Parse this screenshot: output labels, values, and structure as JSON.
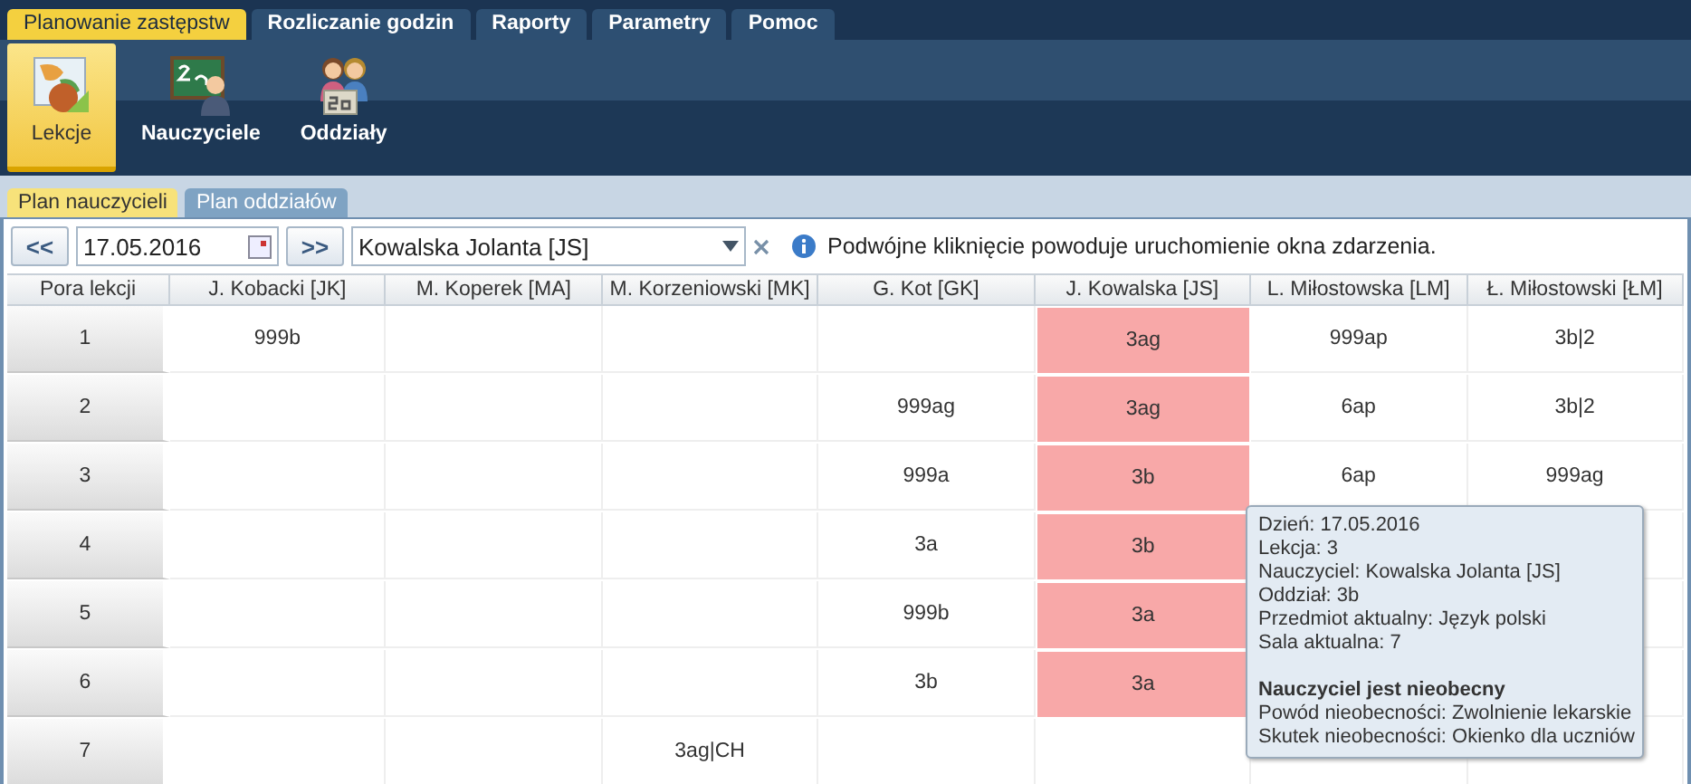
{
  "menu_tabs": [
    {
      "label": "Planowanie zastępstw",
      "selected": true
    },
    {
      "label": "Rozliczanie godzin",
      "selected": false
    },
    {
      "label": "Raporty",
      "selected": false
    },
    {
      "label": "Parametry",
      "selected": false
    },
    {
      "label": "Pomoc",
      "selected": false
    }
  ],
  "ribbon": [
    {
      "label": "Lekcje",
      "kind": "lessons",
      "selected": true
    },
    {
      "label": "Nauczyciele",
      "kind": "teachers",
      "selected": false
    },
    {
      "label": "Oddziały",
      "kind": "classes",
      "selected": false
    }
  ],
  "sub_tabs": [
    {
      "label": "Plan nauczycieli",
      "selected": true
    },
    {
      "label": "Plan oddziałów",
      "selected": false
    }
  ],
  "toolbar": {
    "prev": "<<",
    "date": "17.05.2016",
    "next": ">>",
    "teacher": "Kowalska Jolanta [JS]",
    "info": "Podwójne kliknięcie powoduje uruchomienie okna zdarzenia."
  },
  "table": {
    "columns": [
      "Pora lekcji",
      "J. Kobacki [JK]",
      "M. Koperek [MA]",
      "M. Korzeniowski [MK]",
      "G. Kot [GK]",
      "J. Kowalska [JS]",
      "L. Miłostowska [LM]",
      "Ł. Miłostowski [ŁM]"
    ],
    "rows": [
      {
        "cells": [
          {
            "text": "1"
          },
          {
            "text": "999b"
          },
          {
            "text": ""
          },
          {
            "text": ""
          },
          {
            "text": ""
          },
          {
            "text": "3ag",
            "absent": true
          },
          {
            "text": "999ap"
          },
          {
            "text": "3b|2"
          }
        ]
      },
      {
        "cells": [
          {
            "text": "2"
          },
          {
            "text": ""
          },
          {
            "text": ""
          },
          {
            "text": ""
          },
          {
            "text": "999ag"
          },
          {
            "text": "3ag",
            "absent": true
          },
          {
            "text": "6ap"
          },
          {
            "text": "3b|2"
          }
        ]
      },
      {
        "cells": [
          {
            "text": "3"
          },
          {
            "text": ""
          },
          {
            "text": ""
          },
          {
            "text": ""
          },
          {
            "text": "999a"
          },
          {
            "text": "3b",
            "absent": true
          },
          {
            "text": "6ap"
          },
          {
            "text": "999ag"
          }
        ]
      },
      {
        "cells": [
          {
            "text": "4"
          },
          {
            "text": ""
          },
          {
            "text": ""
          },
          {
            "text": ""
          },
          {
            "text": "3a"
          },
          {
            "text": "3b",
            "absent": true
          },
          null,
          {
            "text": ""
          }
        ]
      },
      {
        "cells": [
          {
            "text": "5"
          },
          {
            "text": ""
          },
          {
            "text": ""
          },
          {
            "text": ""
          },
          {
            "text": "999b"
          },
          {
            "text": "3a",
            "absent": true
          },
          null,
          {
            "text": ""
          }
        ]
      },
      {
        "cells": [
          {
            "text": "6"
          },
          {
            "text": ""
          },
          {
            "text": ""
          },
          {
            "text": ""
          },
          {
            "text": "3b"
          },
          {
            "text": "3a",
            "absent": true
          },
          null,
          {
            "text": ""
          }
        ]
      },
      {
        "cells": [
          {
            "text": "7"
          },
          {
            "text": ""
          },
          {
            "text": ""
          },
          {
            "text": "3ag|CH"
          },
          {
            "text": ""
          },
          {
            "text": ""
          },
          {
            "text": ""
          },
          {
            "text": ""
          }
        ]
      }
    ]
  },
  "tooltip": {
    "lines": [
      "Dzień: 17.05.2016",
      "Lekcja: 3",
      "Nauczyciel: Kowalska Jolanta [JS]",
      "Oddział: 3b",
      "Przedmiot aktualny: Język polski",
      "Sala aktualna: 7"
    ],
    "heading": "Nauczyciel jest nieobecny",
    "details": [
      "Powód nieobecności: Zwolnienie lekarskie",
      "Skutek nieobecności: Okienko dla uczniów"
    ]
  }
}
